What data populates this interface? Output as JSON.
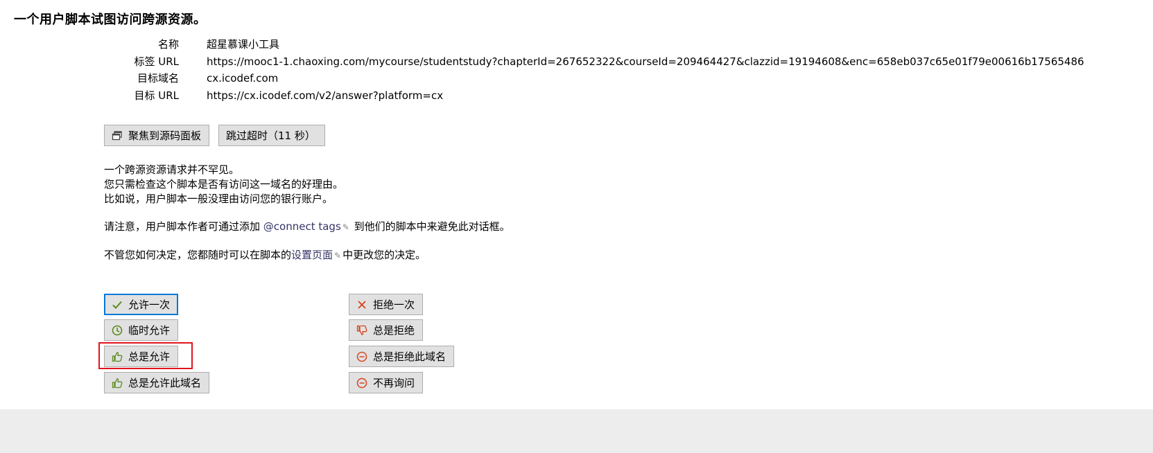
{
  "title": "一个用户脚本试图访问跨源资源。",
  "info": [
    {
      "label": "名称",
      "value": "超星慕课小工具"
    },
    {
      "label": "标签 URL",
      "value": "https://mooc1-1.chaoxing.com/mycourse/studentstudy?chapterId=267652322&courseId=209464427&clazzid=19194608&enc=658eb037c65e01f79e00616b17565486"
    },
    {
      "label": "目标域名",
      "value": "cx.icodef.com"
    },
    {
      "label": "目标 URL",
      "value": "https://cx.icodef.com/v2/answer?platform=cx"
    }
  ],
  "toolbar": {
    "focus_source_label": "聚焦到源码面板",
    "skip_timeout_label": "跳过超时（11 秒）"
  },
  "description": {
    "line1": "一个跨源资源请求并不罕见。",
    "line2": "您只需检查这个脚本是否有访问这一域名的好理由。",
    "line3": "比如说，用户脚本一般没理由访问您的银行账户。",
    "note_prefix": "请注意，用户脚本作者可通过添加 ",
    "note_link": "@connect tags",
    "note_suffix": " 到他们的脚本中来避免此对话框。",
    "settings_prefix": "不管您如何决定，您都随时可以在脚本的",
    "settings_link": "设置页面",
    "settings_suffix": "中更改您的决定。"
  },
  "actions": {
    "allow_once": "允许一次",
    "allow_temp": "临时允许",
    "allow_always": "总是允许",
    "allow_domain": "总是允许此域名",
    "deny_once": "拒绝一次",
    "deny_always": "总是拒绝",
    "deny_domain": "总是拒绝此域名",
    "never_ask": "不再询问"
  },
  "colors": {
    "allow_green": "#5a8a1e",
    "deny_red": "#d9421f",
    "focus_blue": "#0078d7",
    "highlight_red": "#e0141e"
  }
}
